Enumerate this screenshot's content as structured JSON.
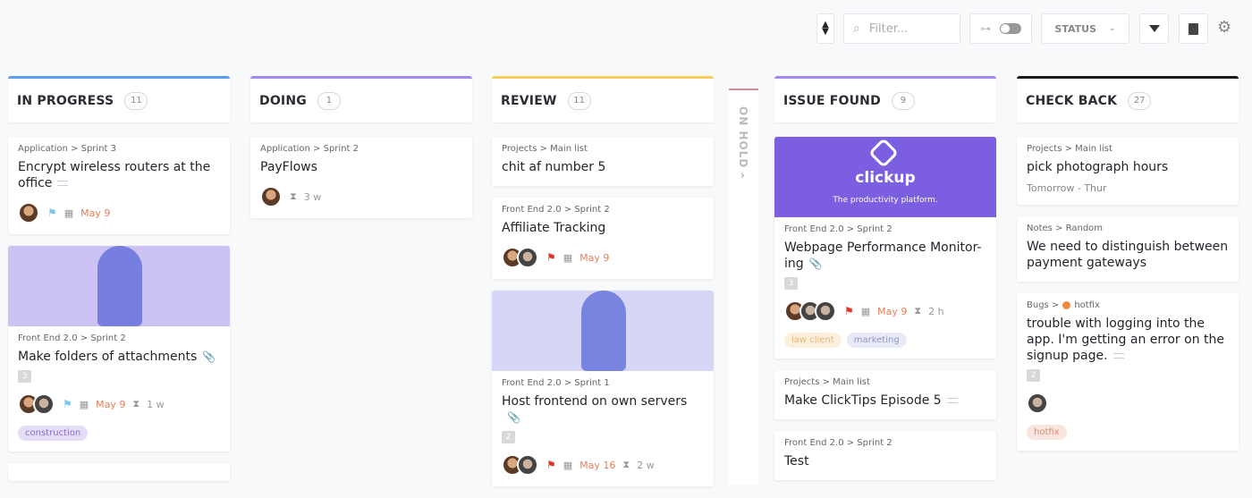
{
  "toolbar": {
    "filter_placeholder": "Filter...",
    "status_label": "STATUS"
  },
  "on_hold": {
    "label": "ON HOLD",
    "chevron": "›"
  },
  "columns": [
    {
      "name": "IN PROGRESS",
      "count": "11",
      "color": "#5e9cf0",
      "cards": [
        {
          "crumb": "Application > Sprint 3",
          "title": "Encrypt wireless routers at the office",
          "desc": true,
          "avatars": [
            "a"
          ],
          "flag": "#7cc7ea",
          "date": "May 9"
        },
        {
          "image": "#ccc2f4",
          "crumb": "Front End 2.0 > Sprint 2",
          "title": "Make folders of attachments",
          "attach": true,
          "subtasks": "3",
          "avatars": [
            "a",
            "b"
          ],
          "flag": "#7cc7ea",
          "date": "May 9",
          "time": "1 w",
          "tags": [
            {
              "label": "construction",
              "bg": "#e5dcf7",
              "fg": "#8c73c7"
            }
          ]
        },
        {
          "crumb": "",
          "title": ""
        }
      ]
    },
    {
      "name": "DOING",
      "count": "1",
      "color": "#a28af0",
      "cards": [
        {
          "crumb": "Application > Sprint 2",
          "title": "PayFlows",
          "avatars": [
            "a"
          ],
          "time": "3 w"
        }
      ]
    },
    {
      "name": "REVIEW",
      "count": "11",
      "color": "#f7cf5c",
      "cards": [
        {
          "crumb": "Projects > Main list",
          "title": "chit af number 5"
        },
        {
          "crumb": "Front End 2.0 > Sprint 2",
          "title": "Affiliate Tracking",
          "avatars": [
            "a",
            "b"
          ],
          "flag": "#e0362e",
          "date": "May 9"
        },
        {
          "image": "#d7d6f6",
          "crumb": "Front End 2.0 >    Sprint 1",
          "title": "Host frontend on own servers",
          "attach": true,
          "subtasks": "2",
          "avatars": [
            "a",
            "b"
          ],
          "flag": "#e0362e",
          "date": "May 16",
          "time": "2 w"
        }
      ]
    },
    {
      "name": "ISSUE FOUND",
      "count": "9",
      "color": "#a28af0",
      "cards": [
        {
          "image": "#7b5fe0",
          "logo": "clickup",
          "tagline": "The productivity platform.",
          "crumb": "Front End 2.0 > Sprint 2",
          "title": "Webpage Performance Monitor-ing",
          "attach": true,
          "subtasks": "3",
          "avatars": [
            "a",
            "b",
            "b"
          ],
          "flag": "#e0362e",
          "date": "May 9",
          "time": "2 h",
          "tags": [
            {
              "label": "law client",
              "bg": "#fcf0dc",
              "fg": "#e0b57a"
            },
            {
              "label": "marketing",
              "bg": "#e8eaf8",
              "fg": "#8e95c4"
            }
          ]
        },
        {
          "crumb": "Projects > Main list",
          "title": "Make ClickTips Episode 5",
          "desc": true
        },
        {
          "crumb": "Front End 2.0 > Sprint 2",
          "title": "Test"
        }
      ]
    },
    {
      "name": "CHECK BACK",
      "count": "27",
      "color": "#1a1a1a",
      "cards": [
        {
          "crumb": "Projects > Main list",
          "title": "pick photograph hours",
          "extra": "Tomorrow - Thur"
        },
        {
          "crumb": "Notes > Random",
          "title": "We need to distinguish between payment gateways"
        },
        {
          "crumb": "Bugs >",
          "crumb_dot": "hotfix",
          "title": "trouble with logging into the app. I'm getting an error on the signup page.",
          "desc": true,
          "subtasks": "2",
          "avatars": [
            "b"
          ],
          "tags": [
            {
              "label": "hotfix",
              "bg": "#fbe6df",
              "fg": "#e08a6c"
            }
          ]
        }
      ]
    }
  ]
}
